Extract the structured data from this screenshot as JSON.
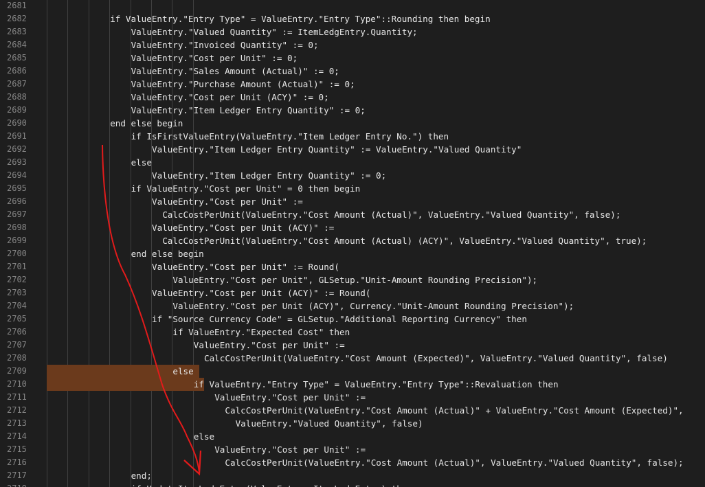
{
  "editor": {
    "lines": [
      {
        "n": "2681",
        "indent": 0,
        "text": ""
      },
      {
        "n": "2682",
        "indent": 12,
        "text": "if ValueEntry.\"Entry Type\" = ValueEntry.\"Entry Type\"::Rounding then begin"
      },
      {
        "n": "2683",
        "indent": 16,
        "text": "ValueEntry.\"Valued Quantity\" := ItemLedgEntry.Quantity;"
      },
      {
        "n": "2684",
        "indent": 16,
        "text": "ValueEntry.\"Invoiced Quantity\" := 0;"
      },
      {
        "n": "2685",
        "indent": 16,
        "text": "ValueEntry.\"Cost per Unit\" := 0;"
      },
      {
        "n": "2686",
        "indent": 16,
        "text": "ValueEntry.\"Sales Amount (Actual)\" := 0;"
      },
      {
        "n": "2687",
        "indent": 16,
        "text": "ValueEntry.\"Purchase Amount (Actual)\" := 0;"
      },
      {
        "n": "2688",
        "indent": 16,
        "text": "ValueEntry.\"Cost per Unit (ACY)\" := 0;"
      },
      {
        "n": "2689",
        "indent": 16,
        "text": "ValueEntry.\"Item Ledger Entry Quantity\" := 0;"
      },
      {
        "n": "2690",
        "indent": 12,
        "text": "end else begin"
      },
      {
        "n": "2691",
        "indent": 16,
        "text": "if IsFirstValueEntry(ValueEntry.\"Item Ledger Entry No.\") then"
      },
      {
        "n": "2692",
        "indent": 20,
        "text": "ValueEntry.\"Item Ledger Entry Quantity\" := ValueEntry.\"Valued Quantity\""
      },
      {
        "n": "2693",
        "indent": 16,
        "text": "else"
      },
      {
        "n": "2694",
        "indent": 20,
        "text": "ValueEntry.\"Item Ledger Entry Quantity\" := 0;"
      },
      {
        "n": "2695",
        "indent": 16,
        "text": "if ValueEntry.\"Cost per Unit\" = 0 then begin"
      },
      {
        "n": "2696",
        "indent": 20,
        "text": "ValueEntry.\"Cost per Unit\" :="
      },
      {
        "n": "2697",
        "indent": 22,
        "text": "CalcCostPerUnit(ValueEntry.\"Cost Amount (Actual)\", ValueEntry.\"Valued Quantity\", false);"
      },
      {
        "n": "2698",
        "indent": 20,
        "text": "ValueEntry.\"Cost per Unit (ACY)\" :="
      },
      {
        "n": "2699",
        "indent": 22,
        "text": "CalcCostPerUnit(ValueEntry.\"Cost Amount (Actual) (ACY)\", ValueEntry.\"Valued Quantity\", true);"
      },
      {
        "n": "2700",
        "indent": 16,
        "text": "end else begin"
      },
      {
        "n": "2701",
        "indent": 20,
        "text": "ValueEntry.\"Cost per Unit\" := Round("
      },
      {
        "n": "2702",
        "indent": 24,
        "text": "ValueEntry.\"Cost per Unit\", GLSetup.\"Unit-Amount Rounding Precision\");"
      },
      {
        "n": "2703",
        "indent": 20,
        "text": "ValueEntry.\"Cost per Unit (ACY)\" := Round("
      },
      {
        "n": "2704",
        "indent": 24,
        "text": "ValueEntry.\"Cost per Unit (ACY)\", Currency.\"Unit-Amount Rounding Precision\");"
      },
      {
        "n": "2705",
        "indent": 20,
        "text": "if \"Source Currency Code\" = GLSetup.\"Additional Reporting Currency\" then"
      },
      {
        "n": "2706",
        "indent": 24,
        "text": "if ValueEntry.\"Expected Cost\" then"
      },
      {
        "n": "2707",
        "indent": 28,
        "text": "ValueEntry.\"Cost per Unit\" :="
      },
      {
        "n": "2708",
        "indent": 30,
        "text": "CalcCostPerUnit(ValueEntry.\"Cost Amount (Expected)\", ValueEntry.\"Valued Quantity\", false)"
      },
      {
        "n": "2709",
        "indent": 24,
        "text": "else"
      },
      {
        "n": "2710",
        "indent": 28,
        "text": "if ValueEntry.\"Entry Type\" = ValueEntry.\"Entry Type\"::Revaluation then"
      },
      {
        "n": "2711",
        "indent": 32,
        "text": "ValueEntry.\"Cost per Unit\" :="
      },
      {
        "n": "2712",
        "indent": 34,
        "text": "CalcCostPerUnit(ValueEntry.\"Cost Amount (Actual)\" + ValueEntry.\"Cost Amount (Expected)\","
      },
      {
        "n": "2713",
        "indent": 36,
        "text": "ValueEntry.\"Valued Quantity\", false)"
      },
      {
        "n": "2714",
        "indent": 28,
        "text": "else"
      },
      {
        "n": "2715",
        "indent": 32,
        "text": "ValueEntry.\"Cost per Unit\" :="
      },
      {
        "n": "2716",
        "indent": 34,
        "text": "CalcCostPerUnit(ValueEntry.\"Cost Amount (Actual)\", ValueEntry.\"Valued Quantity\", false);"
      },
      {
        "n": "2717",
        "indent": 16,
        "text": "end;"
      },
      {
        "n": "2718",
        "indent": 16,
        "text": "if UpdateItemLedgEntry(ValueEntry, ItemLedgEntry) then"
      }
    ]
  },
  "colors": {
    "background": "#1e1e1e",
    "text": "#e6e6e6",
    "line_number": "#858585",
    "selection": "#6b3a1c",
    "annotation_arrow": "#e31b1b"
  }
}
